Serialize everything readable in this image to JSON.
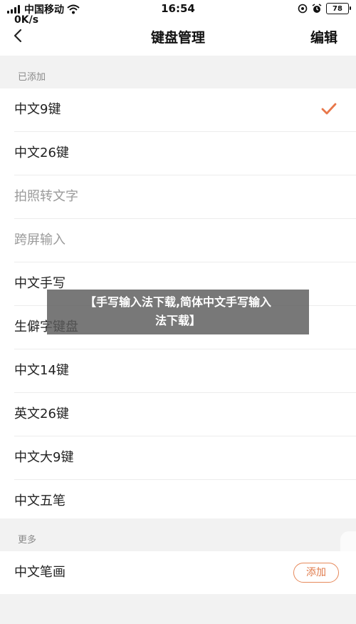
{
  "status_bar": {
    "carrier": "中国移动",
    "speed": "0K/s",
    "time": "16:54",
    "battery": "78"
  },
  "nav": {
    "back_icon": "chevron-left-icon",
    "title": "键盘管理",
    "edit_label": "编辑"
  },
  "added": {
    "header": "已添加",
    "items": [
      {
        "label": "中文9键",
        "selected": true,
        "disabled": false
      },
      {
        "label": "中文26键",
        "selected": false,
        "disabled": false
      },
      {
        "label": "拍照转文字",
        "selected": false,
        "disabled": true
      },
      {
        "label": "跨屏输入",
        "selected": false,
        "disabled": true
      },
      {
        "label": "中文手写",
        "selected": false,
        "disabled": false
      },
      {
        "label": "生僻字键盘",
        "selected": false,
        "disabled": false
      },
      {
        "label": "中文14键",
        "selected": false,
        "disabled": false
      },
      {
        "label": "英文26键",
        "selected": false,
        "disabled": false
      },
      {
        "label": "中文大9键",
        "selected": false,
        "disabled": false
      },
      {
        "label": "中文五笔",
        "selected": false,
        "disabled": false
      }
    ]
  },
  "more": {
    "header": "更多",
    "items": [
      {
        "label": "中文笔画",
        "button": "添加"
      }
    ]
  },
  "watermark": {
    "line1": "【手写输入法下载,简体中文手写输入",
    "line2": "法下载】"
  },
  "colors": {
    "accent": "#e8774a",
    "background": "#f2f2f2"
  }
}
